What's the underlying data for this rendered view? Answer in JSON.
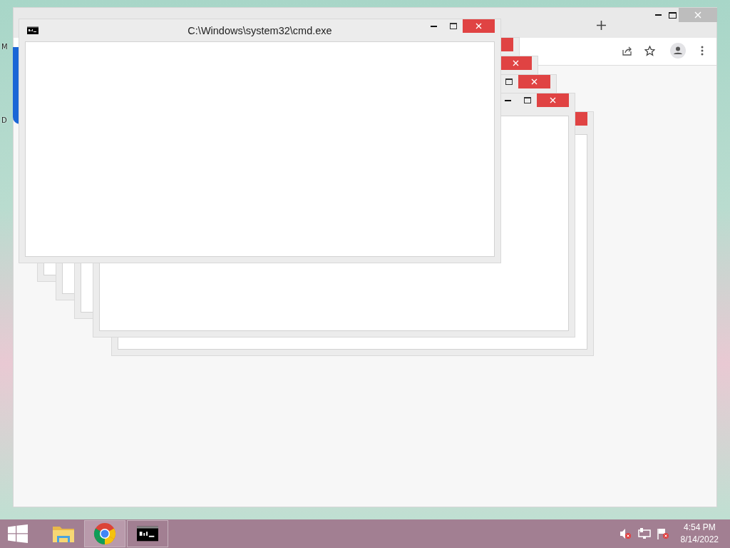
{
  "desktop": {
    "icon_labels": [
      "M",
      "D"
    ]
  },
  "windows": [
    {
      "kind": "console",
      "title": "C:\\Windows\\system32\\cmd.exe"
    },
    {
      "kind": "console"
    },
    {
      "kind": "console"
    },
    {
      "kind": "console"
    },
    {
      "kind": "console"
    },
    {
      "kind": "console"
    }
  ],
  "taskbar": {
    "apps": [
      {
        "kind": "files",
        "running": false,
        "selected": false
      },
      {
        "kind": "browser",
        "running": true,
        "selected": true
      },
      {
        "kind": "console",
        "running": true,
        "selected": false
      }
    ],
    "clock": {
      "time": "4:54 PM",
      "date": "8/14/2022"
    }
  }
}
